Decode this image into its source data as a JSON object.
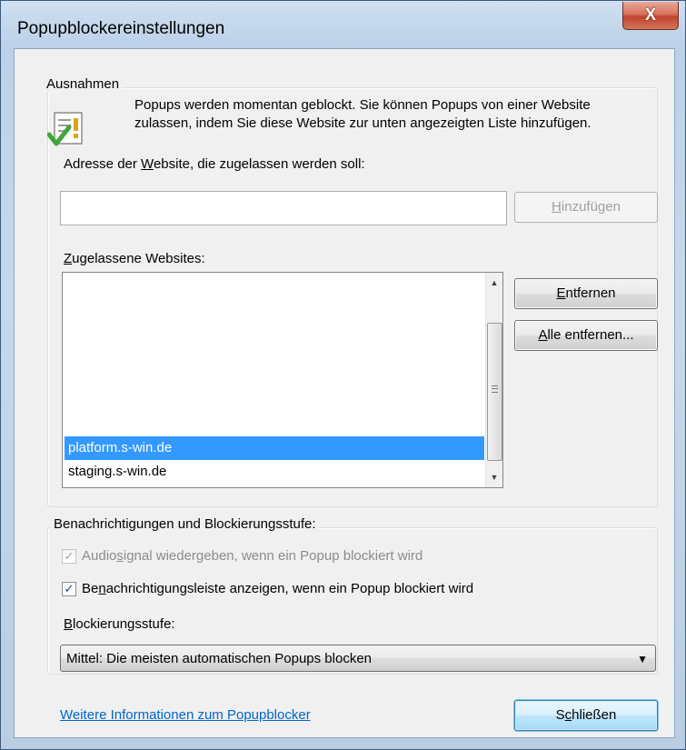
{
  "window": {
    "title": "Popupblockereinstellungen",
    "close_glyph": "X"
  },
  "exceptions": {
    "group_label": "Ausnahmen",
    "info_icon": "document-check-warning-icon",
    "info_text": "Popups werden momentan geblockt. Sie können Popups von einer Website zulassen, indem Sie diese Website zur unten angezeigten Liste hinzufügen.",
    "address_label_pre": "Adresse der ",
    "address_label_u": "W",
    "address_label_post": "ebsite, die zugelassen werden soll:",
    "address_value": "",
    "add_button_u": "H",
    "add_button_post": "inzufügen",
    "allowed_label_u": "Z",
    "allowed_label_post": "ugelassene Websites:",
    "allowed_sites": [
      {
        "label": "platform.s-win.de",
        "selected": true
      },
      {
        "label": "staging.s-win.de",
        "selected": false
      }
    ],
    "remove_button_u": "E",
    "remove_button_post": "ntfernen",
    "remove_all_button_u": "A",
    "remove_all_button_post": "lle entfernen..."
  },
  "notifications": {
    "group_label": "Benachrichtigungen und Blockierungsstufe:",
    "sound_checkbox": {
      "checked": true,
      "enabled": false,
      "label_pre": "Audio",
      "label_u": "s",
      "label_post": "ignal wiedergeben, wenn ein Popup blockiert wird"
    },
    "infobar_checkbox": {
      "checked": true,
      "enabled": true,
      "label_pre": "Be",
      "label_u": "n",
      "label_post": "achrichtigungsleiste anzeigen, wenn ein Popup blockiert wird"
    },
    "level_label_u": "B",
    "level_label_post": "lockierungsstufe:",
    "level_selected": "Mittel: Die meisten automatischen Popups blocken"
  },
  "footer": {
    "info_link": "Weitere Informationen zum Popupblocker",
    "close_button_pre": "S",
    "close_button_u": "c",
    "close_button_post": "hließen"
  },
  "colors": {
    "selection": "#3399ff",
    "link": "#0066cc"
  }
}
